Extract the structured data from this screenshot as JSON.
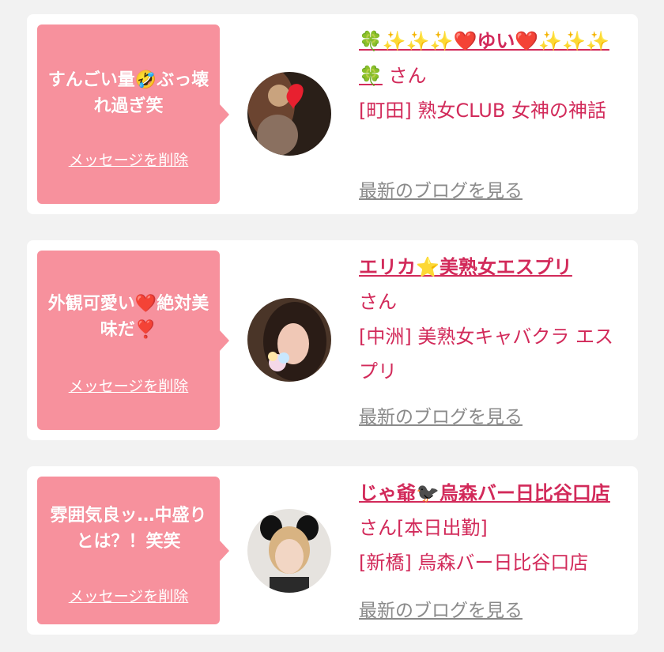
{
  "cards": [
    {
      "message": "すんごい量🤣ぶっ壊れ過ぎ笑",
      "delete_label": "メッセージを削除",
      "name": "🍀✨✨✨❤️ゆい❤️✨✨✨🍀",
      "san": "さん",
      "shop": "[町田] 熟女CLUB 女神の神話",
      "blog_label": "最新のブログを見る"
    },
    {
      "message": "外観可愛い❤️絶対美味だ❣️",
      "delete_label": "メッセージを削除",
      "name": "エリカ⭐美熟女エスプリ",
      "san": "さん",
      "shop": "[中洲] 美熟女キャバクラ エスプリ",
      "blog_label": "最新のブログを見る"
    },
    {
      "message": "雰囲気良ッ…中盛りとは？！笑笑",
      "delete_label": "メッセージを削除",
      "name": "じゃ爺🐦‍⬛烏森バー日比谷口店",
      "san": "さん[本日出勤]",
      "shop": "[新橋] 烏森バー日比谷口店",
      "blog_label": "最新のブログを見る"
    }
  ]
}
